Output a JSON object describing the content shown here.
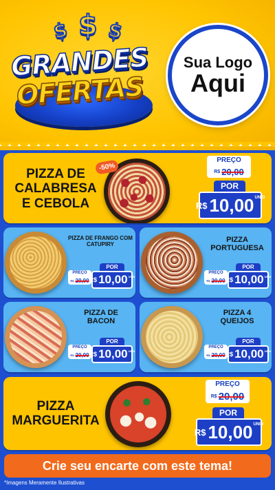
{
  "header": {
    "dollar_sign": "$",
    "title_line1": "GRANDES",
    "title_line2": "OFERTAS",
    "logo_line1": "Sua Logo",
    "logo_line2": "Aqui"
  },
  "labels": {
    "preco": "PREÇO",
    "por": "POR",
    "currency": "R$",
    "unid": "UNID"
  },
  "products": [
    {
      "name": "PIZZA DE CALABRESA E CEBOLA",
      "old_price": "20,00",
      "new_price": "10,00",
      "discount": "-50%",
      "currency_prefix": "R$"
    },
    {
      "name": "PIZZA DE FRANGO COM CATUPIRY",
      "old_price": "20,00",
      "new_price": "10,00",
      "currency_prefix": "R$"
    },
    {
      "name": "PIZZA PORTUGUESA",
      "old_price": "20,00",
      "new_price": "10,00",
      "currency_prefix": "R$"
    },
    {
      "name": "PIZZA DE BACON",
      "old_price": "20,00",
      "new_price": "10,00",
      "currency_prefix": "R$"
    },
    {
      "name": "PIZZA 4 QUEIJOS",
      "old_price": "20,00",
      "new_price": "10,00",
      "currency_prefix": "R$"
    },
    {
      "name": "PIZZA MARGUERITA",
      "old_price": "20,00",
      "new_price": "10,00",
      "currency_prefix": "R$"
    }
  ],
  "footer": {
    "cta": "Crie seu encarte com este tema!",
    "disclaimer": "*Imagens Meramente Ilustrativas"
  },
  "colors": {
    "yellow": "#ffc400",
    "blue_card": "#58b4f2",
    "royal_blue": "#1d3fc6",
    "orange": "#f26a1b",
    "discount_red": "#f15a24"
  }
}
